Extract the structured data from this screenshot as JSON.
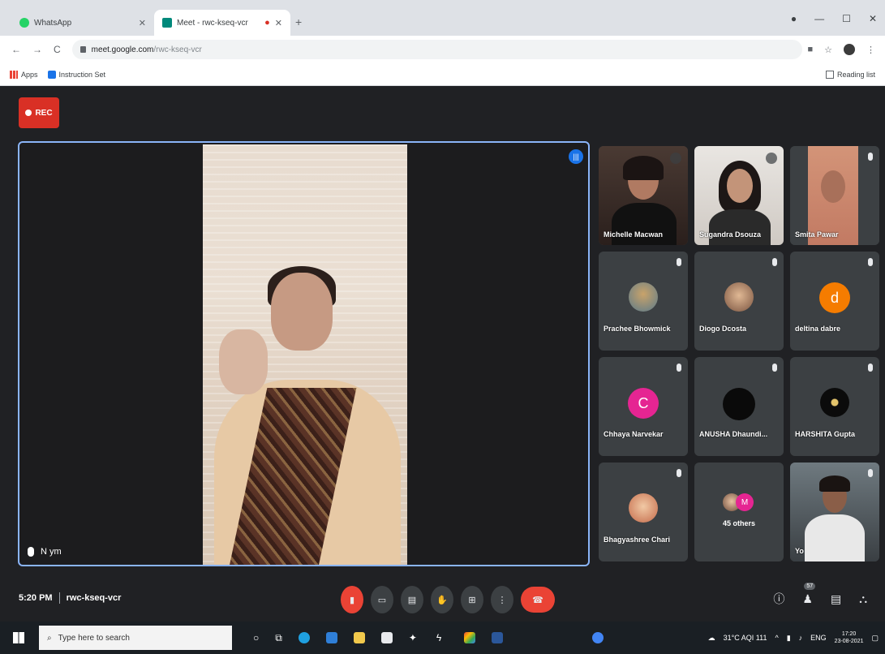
{
  "browser": {
    "tabs": [
      {
        "label": "WhatsApp",
        "favicon_color": "#25d366",
        "active": false
      },
      {
        "label": "Meet - rwc-kseq-vcr",
        "favicon_color": "#00897b",
        "active": true
      }
    ],
    "new_tab_icon": "plus-icon",
    "url_host": "meet.google.com",
    "url_path": "/rwc-kseq-vcr",
    "bookmarks": [
      {
        "label": "Apps"
      },
      {
        "label": "Instruction Set"
      }
    ],
    "reading_list": "Reading list"
  },
  "meet": {
    "rec_label": "REC",
    "main_participant": {
      "name": "N ym",
      "mic_state": "muted"
    },
    "participants": [
      {
        "name": "Michelle Macwan",
        "type": "camera",
        "mic_state": "speaking"
      },
      {
        "name": "Sugandra Dsouza",
        "type": "camera",
        "mic_state": "speaking"
      },
      {
        "name": "Smita Pawar",
        "type": "camera",
        "mic_state": "muted"
      },
      {
        "name": "Prachee Bhowmick",
        "type": "photo",
        "mic_state": "muted"
      },
      {
        "name": "Diogo Dcosta",
        "type": "photo",
        "mic_state": "muted"
      },
      {
        "name": "deltina dabre",
        "type": "letter",
        "letter": "d",
        "color": "#f57c00",
        "mic_state": "muted"
      },
      {
        "name": "Chhaya Narvekar",
        "type": "letter",
        "letter": "C",
        "color": "#e52592",
        "mic_state": "muted"
      },
      {
        "name": "ANUSHA Dhaundi...",
        "type": "photo",
        "mic_state": "muted"
      },
      {
        "name": "HARSHITA Gupta",
        "type": "photo",
        "mic_state": "muted"
      },
      {
        "name": "Bhagyashree Chari",
        "type": "photo",
        "mic_state": "muted"
      },
      {
        "name": "45 others",
        "type": "others",
        "others_letter": "M"
      },
      {
        "name": "Yo",
        "type": "camera",
        "mic_state": "muted"
      }
    ],
    "time": "5:20 PM",
    "meeting_code": "rwc-kseq-vcr",
    "participant_count": "57",
    "controls": [
      "mic-off-icon",
      "camera-icon",
      "captions-icon",
      "raise-hand-icon",
      "present-icon",
      "more-icon",
      "end-call-icon"
    ]
  },
  "taskbar": {
    "search_placeholder": "Type here to search",
    "weather": "31°C AQI 111",
    "language": "ENG",
    "time": "17:20",
    "date": "23-08-2021"
  }
}
